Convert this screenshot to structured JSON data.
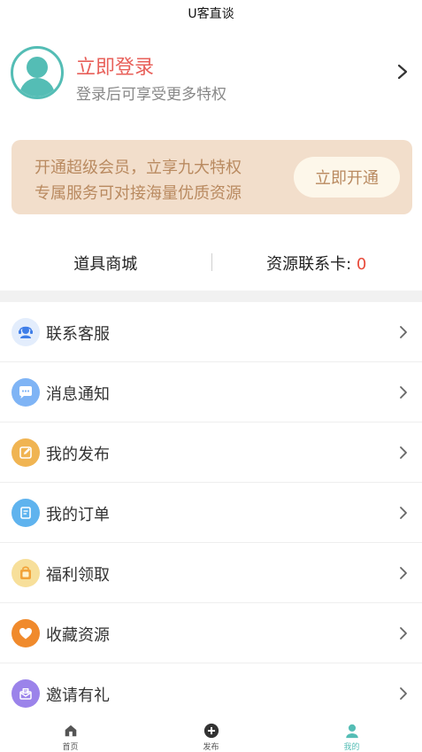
{
  "header": {
    "title": "U客直谈"
  },
  "profile": {
    "login_title": "立即登录",
    "login_subtitle": "登录后可享受更多特权"
  },
  "vip": {
    "line1": "开通超级会员，立享九大特权",
    "line2": "专属服务可对接海量优质资源",
    "button_label": "立即开通"
  },
  "quick": {
    "shop_label": "道具商城",
    "card_label": "资源联系卡:",
    "card_count": "0"
  },
  "menu": [
    {
      "label": "联系客服",
      "icon": "customer-service-icon",
      "color": "#e3edfc"
    },
    {
      "label": "消息通知",
      "icon": "message-icon",
      "color": "#7fb4f5"
    },
    {
      "label": "我的发布",
      "icon": "edit-icon",
      "color": "#f0b452"
    },
    {
      "label": "我的订单",
      "icon": "order-icon",
      "color": "#5fb3ee"
    },
    {
      "label": "福利领取",
      "icon": "gift-bag-icon",
      "color": "#f7df9a"
    },
    {
      "label": "收藏资源",
      "icon": "heart-icon",
      "color": "#f08a2c"
    },
    {
      "label": "邀请有礼",
      "icon": "invite-icon",
      "color": "#9b83ea"
    }
  ],
  "tabs": [
    {
      "label": "首页",
      "icon": "home-icon"
    },
    {
      "label": "发布",
      "icon": "publish-plus-icon"
    },
    {
      "label": "我的",
      "icon": "profile-icon"
    }
  ],
  "colors": {
    "accent": "#54bdb5",
    "login_red": "#e8605a",
    "vip_bg": "#f2decb",
    "vip_text": "#b98a60",
    "count_red": "#e84a3a"
  }
}
